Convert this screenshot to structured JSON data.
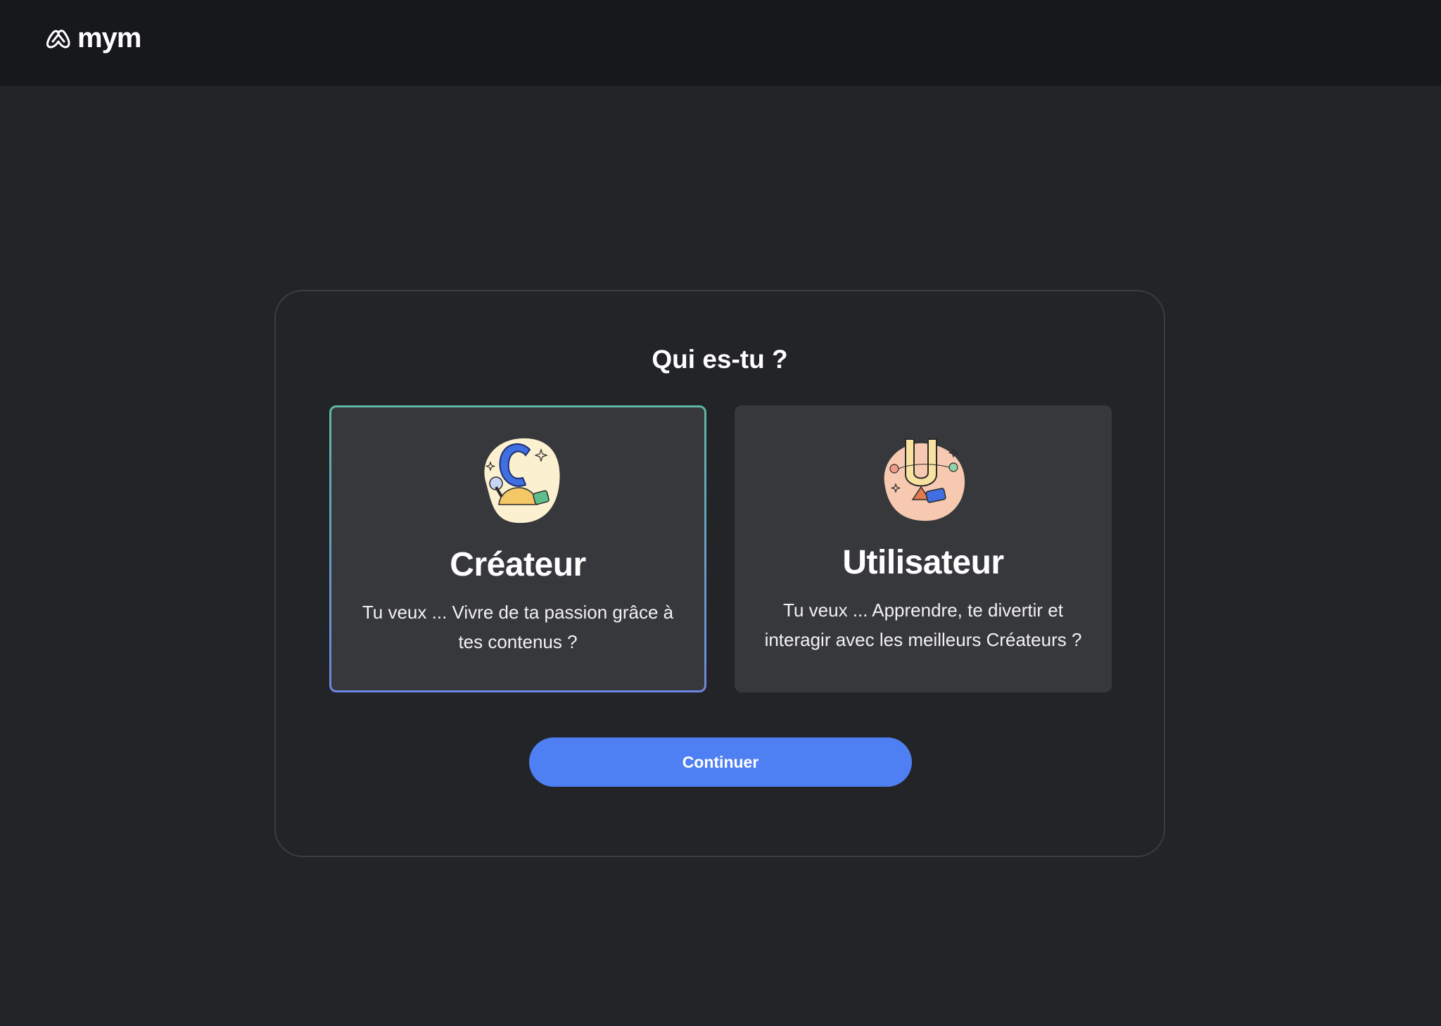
{
  "brand": {
    "name": "mym",
    "icon": "mym-logo-icon"
  },
  "dialog": {
    "title": "Qui es-tu ?",
    "options": [
      {
        "id": "creator",
        "title": "Créateur",
        "description": "Tu veux ... Vivre de ta passion grâce à tes contenus ?",
        "icon": "creator-illustration-icon",
        "selected": true
      },
      {
        "id": "user",
        "title": "Utilisateur",
        "description": "Tu veux ... Apprendre, te divertir et interagir avec les meilleurs Créateurs ?",
        "icon": "user-illustration-icon",
        "selected": false
      }
    ],
    "continue_label": "Continuer"
  },
  "colors": {
    "page_background": "#232427",
    "topbar_background": "#17181c",
    "card_background": "#37383c",
    "selected_border_top": "#5fb7a4",
    "selected_border_bottom": "#6d86e0",
    "primary_button": "#4f80f3"
  }
}
